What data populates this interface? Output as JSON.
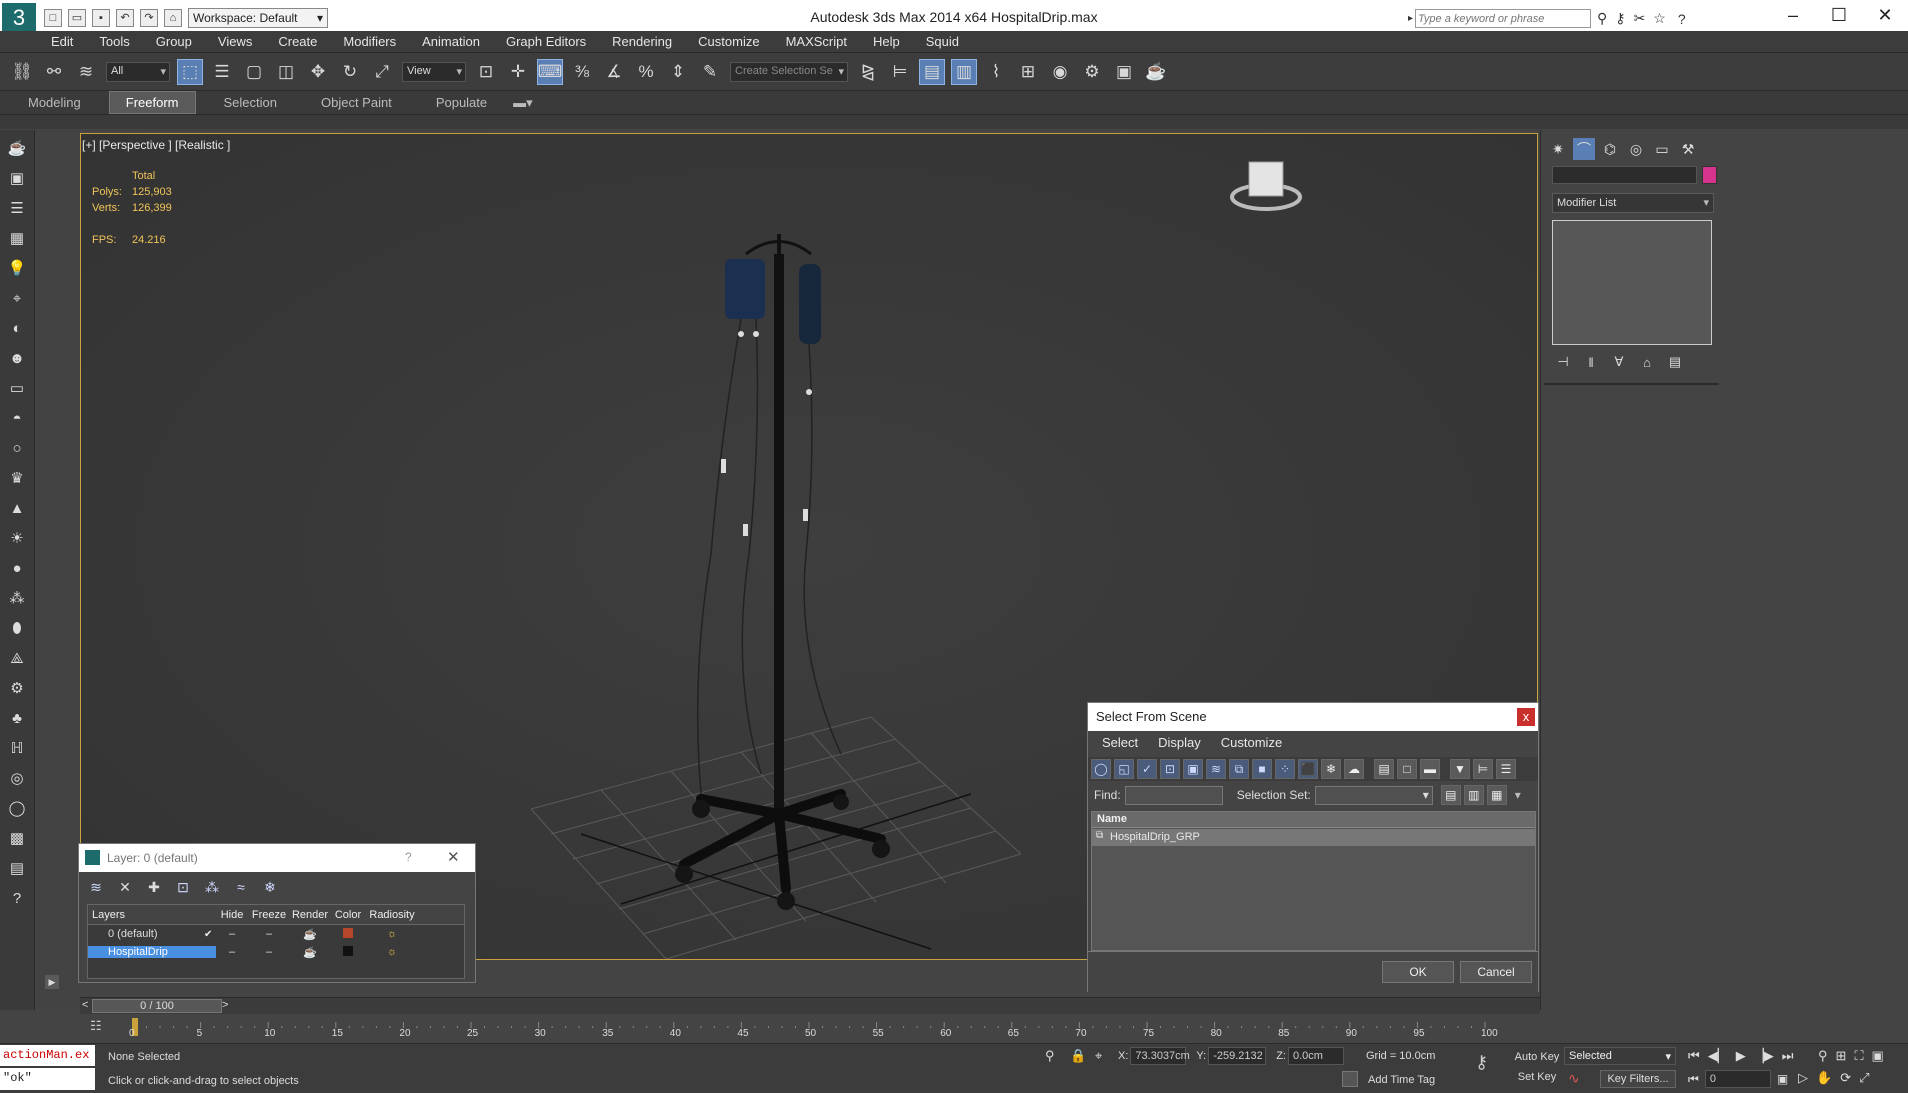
{
  "titlebar": {
    "title": "Autodesk 3ds Max  2014 x64     HospitalDrip.max",
    "workspace": "Workspace: Default",
    "search_placeholder": "Type a keyword or phrase"
  },
  "menu": [
    "Edit",
    "Tools",
    "Group",
    "Views",
    "Create",
    "Modifiers",
    "Animation",
    "Graph Editors",
    "Rendering",
    "Customize",
    "MAXScript",
    "Help",
    "Squid"
  ],
  "toolbar": {
    "filter_value": "All",
    "refcoord_value": "View",
    "selection_set_placeholder": "Create Selection Se"
  },
  "ribbon": {
    "tabs": [
      "Modeling",
      "Freeform",
      "Selection",
      "Object Paint",
      "Populate"
    ],
    "active_tab": "Freeform"
  },
  "viewport": {
    "label": "[+] [Perspective ] [Realistic ]",
    "stats": {
      "header": "Total",
      "polys_label": "Polys:",
      "polys_value": "125,903",
      "verts_label": "Verts:",
      "verts_value": "126,399",
      "fps_label": "FPS:",
      "fps_value": "24.216"
    }
  },
  "command_panel": {
    "modifier_list": "Modifier List",
    "object_color": "#d6348c"
  },
  "select_from_scene": {
    "title": "Select From Scene",
    "close_glyph": "x",
    "menu": [
      "Select",
      "Display",
      "Customize"
    ],
    "find_label": "Find:",
    "find_value": "",
    "selection_set_label": "Selection Set:",
    "selection_set_value": "",
    "column_name": "Name",
    "rows": [
      "HospitalDrip_GRP"
    ],
    "ok_label": "OK",
    "cancel_label": "Cancel"
  },
  "layer_dialog": {
    "title": "Layer: 0 (default)",
    "help_glyph": "?",
    "columns": [
      "Layers",
      "Hide",
      "Freeze",
      "Render",
      "Color",
      "Radiosity"
    ],
    "layers": [
      {
        "name": "0 (default)",
        "color": "#b5462a",
        "active": true
      },
      {
        "name": "HospitalDrip",
        "color": "#111111",
        "active": false
      }
    ]
  },
  "timeline": {
    "frame_display": "0 / 100",
    "prev_glyph": "<",
    "next_glyph": ">",
    "ticks": [
      "0",
      "5",
      "10",
      "15",
      "20",
      "25",
      "30",
      "35",
      "40",
      "45",
      "50",
      "55",
      "60",
      "65",
      "70",
      "75",
      "80",
      "85",
      "90",
      "95",
      "100"
    ]
  },
  "status": {
    "maxscript_line1": "actionMan.ex",
    "maxscript_line2": "\"ok\"",
    "selection_status": "None Selected",
    "prompt": "Click or click-and-drag to select objects",
    "x_label": "X:",
    "x_value": "73.3037cm",
    "y_label": "Y:",
    "y_value": "-259.2132",
    "z_label": "Z:",
    "z_value": "0.0cm",
    "grid": "Grid = 10.0cm",
    "add_time_tag": "Add Time Tag",
    "auto_key": "Auto Key",
    "set_key": "Set Key",
    "selected_dropdown": "Selected",
    "key_filters": "Key Filters...",
    "frame_field": "0"
  }
}
